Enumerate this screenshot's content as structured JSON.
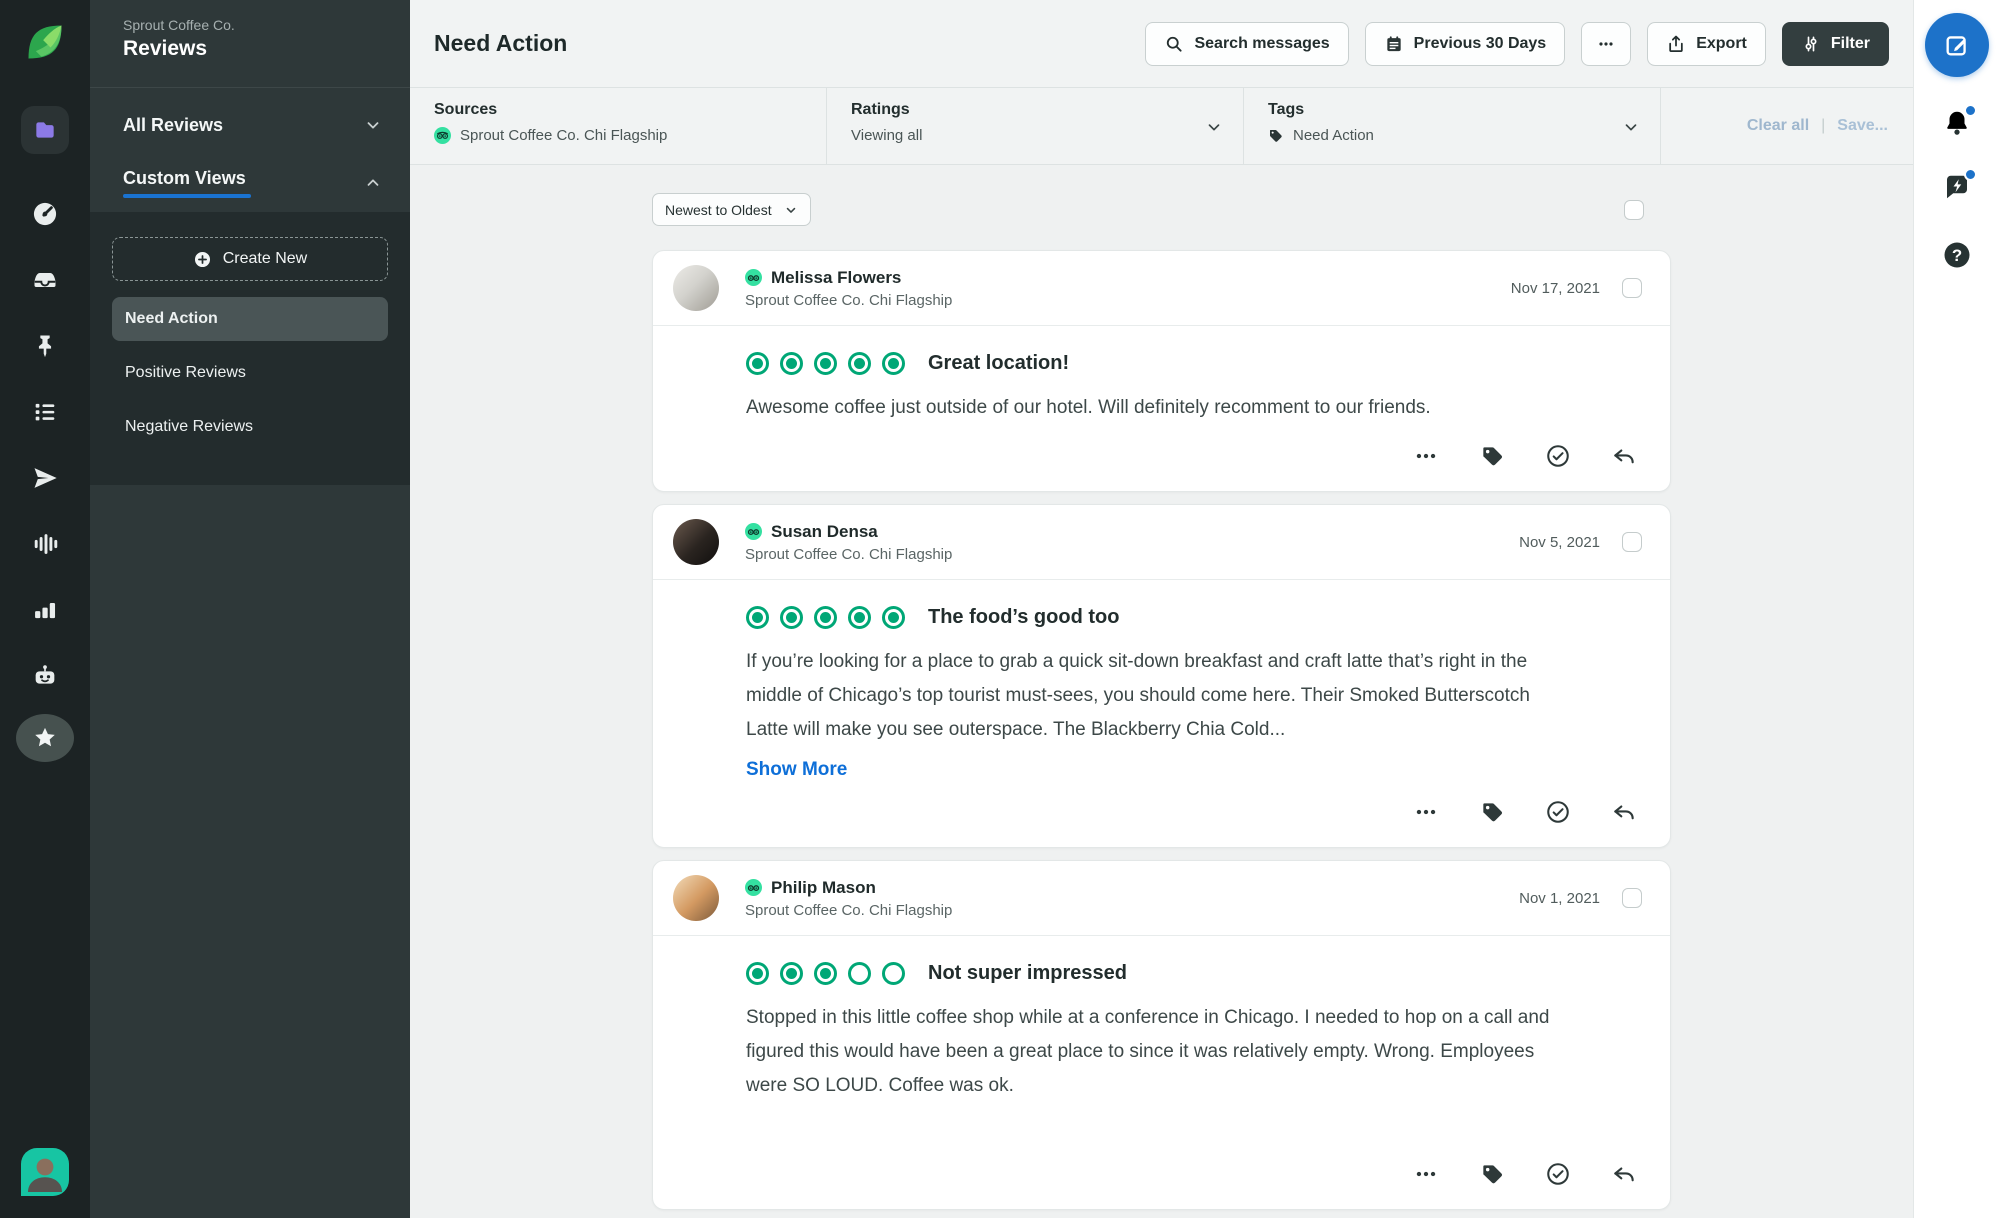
{
  "colors": {
    "accent_blue": "#1D72C9",
    "link_blue": "#0E6FD8",
    "sidebar_active_underline": "#1A73D1",
    "rating_bubble_green": "#00A776",
    "source_badge_green": "#34E0A1",
    "sprout_logo_green": "#2CA64D",
    "folder_icon_purple": "#8C7AE6",
    "avatar_teal": "#17C5A3"
  },
  "rail": {
    "icons": [
      "sprout-logo",
      "folder",
      "gauge",
      "inbox",
      "pin",
      "list",
      "paper-plane",
      "waveform",
      "bar-chart",
      "robot",
      "star"
    ],
    "active_icon": "folder",
    "highlighted_icon": "star"
  },
  "sidebar": {
    "account_name": "Sprout Coffee Co.",
    "title": "Reviews",
    "sections": [
      {
        "label": "All Reviews",
        "state": "collapsed"
      },
      {
        "label": "Custom Views",
        "state": "expanded",
        "active": true
      }
    ],
    "create_new_label": "Create New",
    "custom_views": [
      {
        "label": "Need Action",
        "selected": true
      },
      {
        "label": "Positive Reviews",
        "selected": false
      },
      {
        "label": "Negative Reviews",
        "selected": false
      }
    ]
  },
  "toolbar": {
    "title": "Need Action",
    "search_label": "Search messages",
    "date_range_label": "Previous 30 Days",
    "more_label": "•••",
    "export_label": "Export",
    "filter_label": "Filter"
  },
  "filter_bar": {
    "sources_label": "Sources",
    "sources_value": "Sprout Coffee Co. Chi Flagship",
    "ratings_label": "Ratings",
    "ratings_value": "Viewing all",
    "tags_label": "Tags",
    "tags_value": "Need Action",
    "clear_all_label": "Clear all",
    "save_label": "Save..."
  },
  "list": {
    "sort_value": "Newest to Oldest",
    "select_all_checked": false,
    "show_more_label": "Show More"
  },
  "reviews": [
    {
      "name": "Melissa Flowers",
      "location": "Sprout Coffee Co. Chi Flagship",
      "date": "Nov 17, 2021",
      "rating": 5,
      "max_rating": 5,
      "title": "Great location!",
      "body": "Awesome coffee just outside of our hotel. Will definitely recomment to our friends.",
      "has_show_more": false,
      "checked": false
    },
    {
      "name": "Susan Densa",
      "location": "Sprout Coffee Co. Chi Flagship",
      "date": "Nov 5, 2021",
      "rating": 5,
      "max_rating": 5,
      "title": "The food’s good too",
      "body": "If you’re looking for a place to grab a quick sit-down breakfast and craft latte that’s right in the middle of Chicago’s top tourist must-sees, you should come here. Their Smoked Butterscotch Latte will make you see outerspace. The Blackberry Chia Cold...",
      "has_show_more": true,
      "checked": false
    },
    {
      "name": "Philip Mason",
      "location": "Sprout Coffee Co. Chi Flagship",
      "date": "Nov 1, 2021",
      "rating": 3,
      "max_rating": 5,
      "title": "Not super impressed",
      "body": "Stopped in this little coffee shop while at a conference in Chicago. I needed to hop on a call and figured this would have been a great place to since it was relatively empty. Wrong. Employees were SO LOUD. Coffee was ok.",
      "has_show_more": false,
      "checked": false
    }
  ]
}
